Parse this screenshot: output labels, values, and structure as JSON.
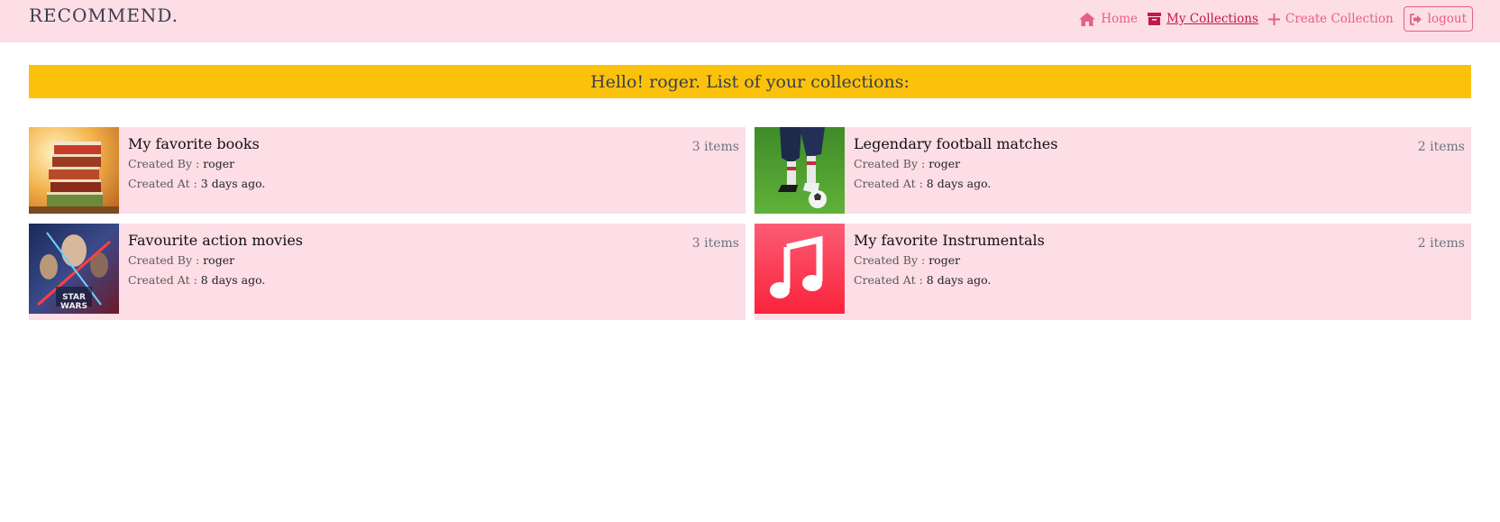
{
  "brand": "RECOMMEND.",
  "nav": {
    "home": "Home",
    "my_collections": "My Collections",
    "create_collection": "Create Collection",
    "logout": "logout"
  },
  "banner": "Hello! roger. List of your collections:",
  "labels": {
    "created_by": "Created By :",
    "created_at": "Created At :"
  },
  "collections": [
    {
      "title": "My favorite books",
      "count": "3 items",
      "author": "roger",
      "created": "3 days ago.",
      "thumb": "books-image"
    },
    {
      "title": "Legendary football matches",
      "count": "2 items",
      "author": "roger",
      "created": "8 days ago.",
      "thumb": "football-image"
    },
    {
      "title": "Favourite action movies",
      "count": "3 items",
      "author": "roger",
      "created": "8 days ago.",
      "thumb": "star-wars-poster"
    },
    {
      "title": "My favorite Instrumentals",
      "count": "2 items",
      "author": "roger",
      "created": "8 days ago.",
      "thumb": "music-note-icon"
    }
  ],
  "colors": {
    "nav_bg": "#fddde6",
    "accent": "#e4608a",
    "banner_bg": "#fcc20b",
    "card_bg": "#fddde6"
  }
}
